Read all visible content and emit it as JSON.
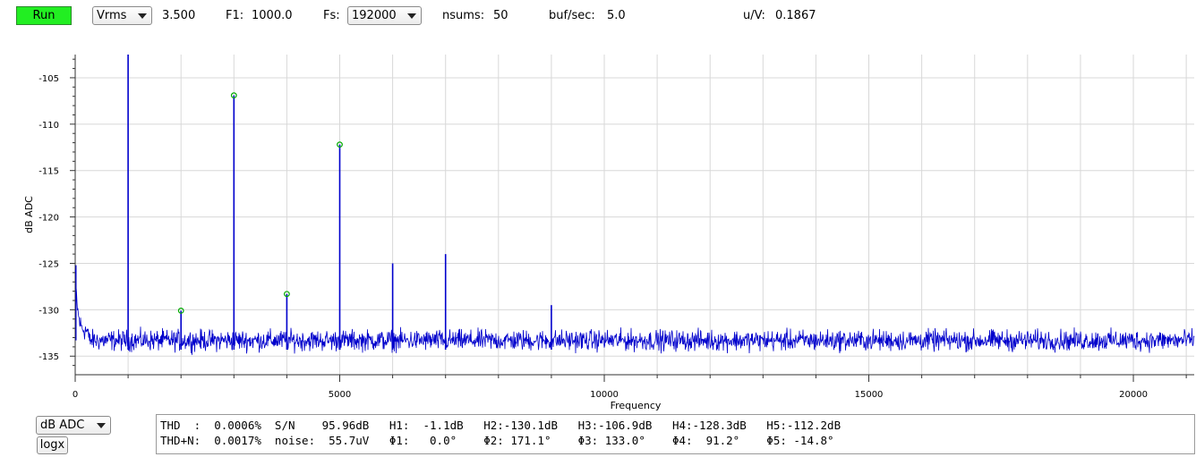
{
  "toolbar": {
    "run_label": "Run",
    "unit_select": "Vrms",
    "level_value": "3.500",
    "f1_label": "F1:",
    "f1_value": "1000.0",
    "fs_label": "Fs:",
    "fs_select": "192000",
    "nsums_label": "nsums:",
    "nsums_value": "50",
    "bufsec_label": "buf/sec:",
    "bufsec_value": "5.0",
    "uv_label": "u/V:",
    "uv_value": "0.1867"
  },
  "bottom": {
    "scale_select": "dB ADC",
    "logx_label": "logx",
    "stats_line1": "THD  :  0.0006%  S/N    95.96dB   H1:  -1.1dB   H2:-130.1dB   H3:-106.9dB   H4:-128.3dB   H5:-112.2dB",
    "stats_line2": "THD+N:  0.0017%  noise:  55.7uV   Φ1:   0.0°    Φ2: 171.1°    Φ3: 133.0°    Φ4:  91.2°    Φ5: -14.8°"
  },
  "colors": {
    "trace": "#0000cc",
    "marker": "#00aa00",
    "run_button": "#22ee22",
    "grid": "#d8d8d8"
  },
  "chart_data": {
    "type": "line",
    "xlabel": "Frequency",
    "ylabel": "dB ADC",
    "xlim": [
      0,
      21150
    ],
    "ylim": [
      -137,
      -102.5
    ],
    "xticks": [
      0,
      5000,
      10000,
      15000,
      20000
    ],
    "yticks": [
      -105,
      -110,
      -115,
      -120,
      -125,
      -130,
      -135
    ],
    "grid": true,
    "noise_floor_db": -133.3,
    "series": [
      {
        "peaks": [
          {
            "x": 1000,
            "y": -102.5
          },
          {
            "x": 2000,
            "y": -130.1
          },
          {
            "x": 3000,
            "y": -106.9
          },
          {
            "x": 4000,
            "y": -128.3
          },
          {
            "x": 5000,
            "y": -112.2
          },
          {
            "x": 6000,
            "y": -125.0
          },
          {
            "x": 7000,
            "y": -124.0
          },
          {
            "x": 9000,
            "y": -129.5
          }
        ]
      }
    ],
    "harmonic_markers": [
      {
        "x": 2000,
        "y": -130.1
      },
      {
        "x": 3000,
        "y": -106.9
      },
      {
        "x": 4000,
        "y": -128.3
      },
      {
        "x": 5000,
        "y": -112.2
      }
    ]
  }
}
